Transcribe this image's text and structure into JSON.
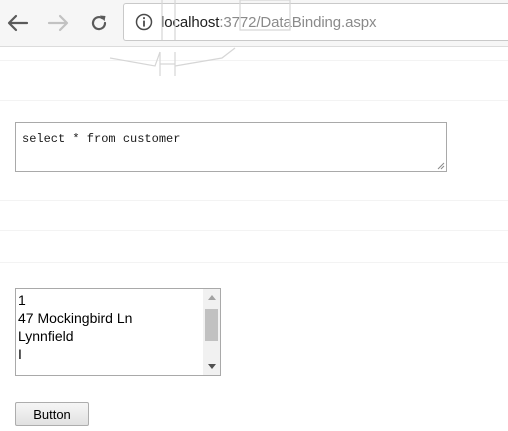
{
  "browser": {
    "url_host": "localhost",
    "url_path": ":3772/DataBinding.aspx",
    "back_icon": "arrow-left-icon",
    "forward_icon": "arrow-right-icon",
    "reload_icon": "reload-icon",
    "info_icon": "info-circle-icon"
  },
  "form": {
    "query_value": "select * from customer",
    "list_items": [
      "1",
      "47 Mockingbird Ln",
      "Lynnfield",
      "I"
    ],
    "button_label": "Button"
  },
  "colors": {
    "url_host": "#202020",
    "url_path": "#8a8a8a",
    "toolbar_bg": "#f6f6f6"
  }
}
